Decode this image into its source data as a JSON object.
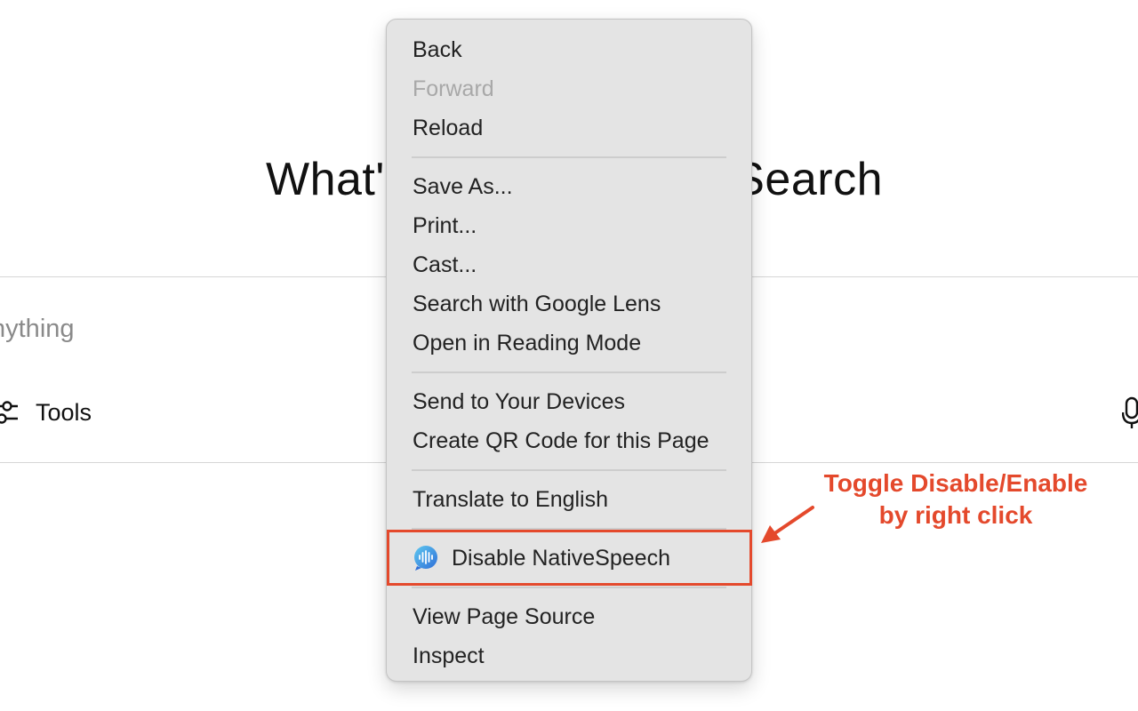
{
  "background": {
    "heading": "What's on your mind? Search",
    "search_placeholder": "nything",
    "tools_label": "Tools"
  },
  "context_menu": {
    "items": [
      {
        "label": "Back",
        "enabled": true
      },
      {
        "label": "Forward",
        "enabled": false
      },
      {
        "label": "Reload",
        "enabled": true
      },
      {
        "label": "Save As...",
        "enabled": true
      },
      {
        "label": "Print...",
        "enabled": true
      },
      {
        "label": "Cast...",
        "enabled": true
      },
      {
        "label": "Search with Google Lens",
        "enabled": true
      },
      {
        "label": "Open in Reading Mode",
        "enabled": true
      },
      {
        "label": "Send to Your Devices",
        "enabled": true
      },
      {
        "label": "Create QR Code for this Page",
        "enabled": true
      },
      {
        "label": "Translate to English",
        "enabled": true
      },
      {
        "label": "Disable NativeSpeech",
        "enabled": true,
        "icon": "native-speech-icon"
      },
      {
        "label": "View Page Source",
        "enabled": true
      },
      {
        "label": "Inspect",
        "enabled": true
      }
    ]
  },
  "annotation": {
    "line1": "Toggle Disable/Enable",
    "line2": "by right click",
    "color": "#e4492c"
  },
  "colors": {
    "menu_background": "#e4e4e4",
    "disabled_text": "#a8a8a8",
    "accent": "#e4492c"
  }
}
